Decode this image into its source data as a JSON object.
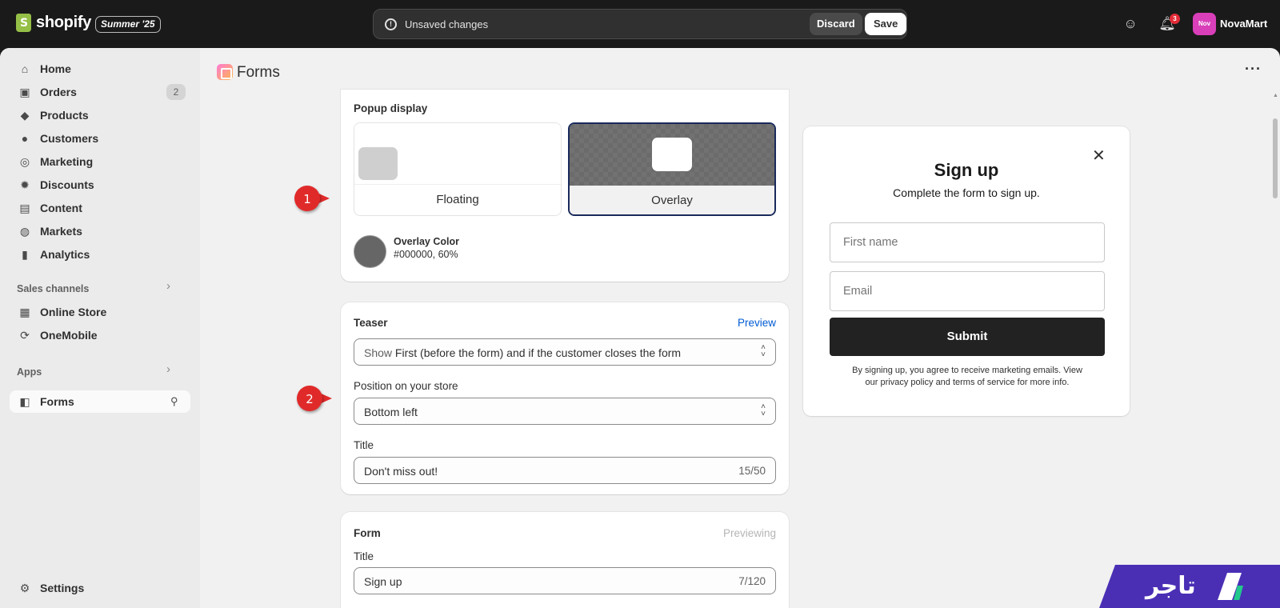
{
  "topbar": {
    "logo_text": "shopify",
    "edition": "Summer '25",
    "unsaved_text": "Unsaved changes",
    "discard_label": "Discard",
    "save_label": "Save",
    "notification_count": "3",
    "avatar_initials": "Nov",
    "store_name": "NovaMart"
  },
  "sidebar": {
    "items": [
      {
        "label": "Home",
        "icon": "home-icon"
      },
      {
        "label": "Orders",
        "icon": "inbox-icon",
        "count": "2"
      },
      {
        "label": "Products",
        "icon": "tag-icon"
      },
      {
        "label": "Customers",
        "icon": "person-icon"
      },
      {
        "label": "Marketing",
        "icon": "target-icon"
      },
      {
        "label": "Discounts",
        "icon": "discount-icon"
      },
      {
        "label": "Content",
        "icon": "image-icon"
      },
      {
        "label": "Markets",
        "icon": "globe-icon"
      },
      {
        "label": "Analytics",
        "icon": "bar-chart-icon"
      }
    ],
    "sales_channels_label": "Sales channels",
    "channels": [
      {
        "label": "Online Store",
        "icon": "store-icon"
      },
      {
        "label": "OneMobile",
        "icon": "mobile-app-icon"
      }
    ],
    "apps_label": "Apps",
    "apps": [
      {
        "label": "Forms",
        "icon": "forms-icon"
      }
    ],
    "settings_label": "Settings"
  },
  "page": {
    "title": "Forms"
  },
  "popup_display": {
    "heading": "Popup display",
    "options": [
      {
        "label": "Floating",
        "selected": false
      },
      {
        "label": "Overlay",
        "selected": true
      }
    ],
    "overlay_color_title": "Overlay Color",
    "overlay_color_value": "#000000, 60%"
  },
  "teaser": {
    "heading": "Teaser",
    "preview_link": "Preview",
    "show_prefix": "Show",
    "show_value": "First (before the form) and if the customer closes the form",
    "position_label": "Position on your store",
    "position_value": "Bottom left",
    "title_label": "Title",
    "title_value": "Don't miss out!",
    "title_counter": "15/50"
  },
  "form": {
    "heading": "Form",
    "status": "Previewing",
    "title_label": "Title",
    "title_value": "Sign up",
    "title_counter": "7/120"
  },
  "preview": {
    "title": "Sign up",
    "subtitle": "Complete the form to sign up.",
    "first_name_placeholder": "First name",
    "email_placeholder": "Email",
    "submit_label": "Submit",
    "fine_print": "By signing up, you agree to receive marketing emails. View our privacy policy and terms of service for more info."
  },
  "annotations": [
    {
      "number": "1"
    },
    {
      "number": "2"
    }
  ],
  "watermark": {
    "text": "تاجر"
  },
  "colors": {
    "topbar": "#1a1a1a",
    "annotation_red": "#e02a2a",
    "link_blue": "#005bd3",
    "selected_border": "#1a2a5c",
    "watermark_purple": "#4a2fb5"
  }
}
